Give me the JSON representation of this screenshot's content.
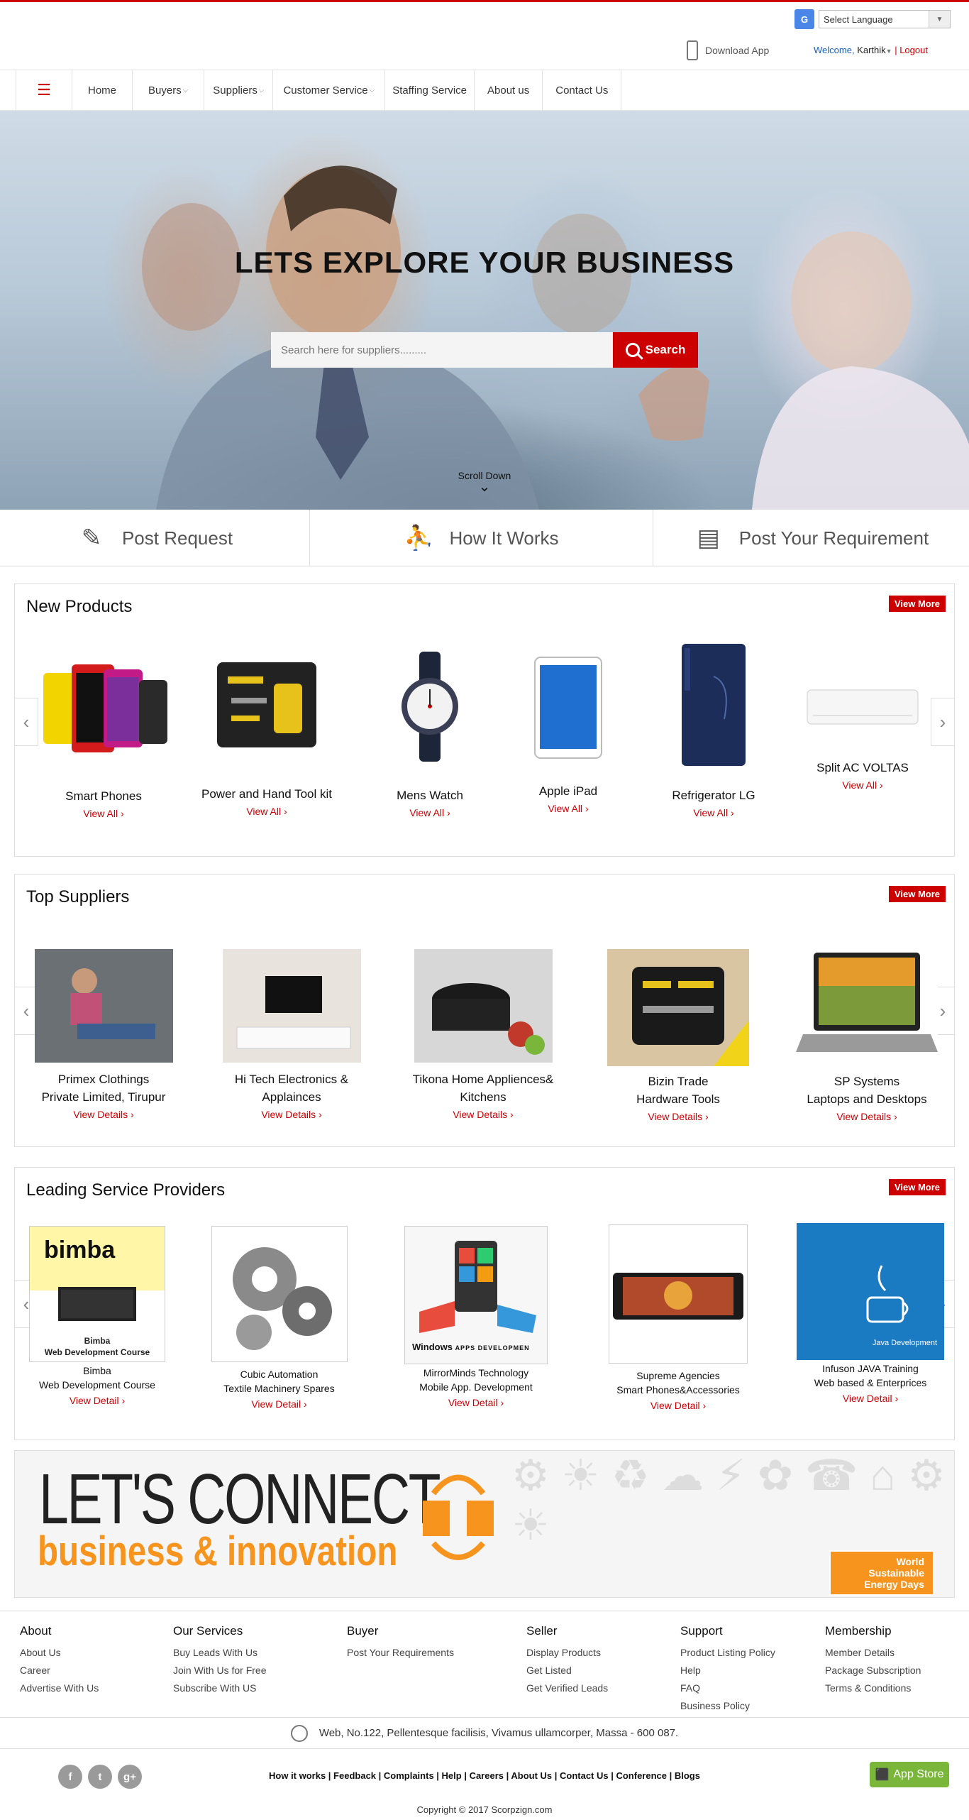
{
  "top": {
    "language_select": "Select Language",
    "download_app": "Download App",
    "welcome": "Welcome,",
    "user": "Karthik",
    "logout": "Logout"
  },
  "nav": {
    "items": [
      "Home",
      "Buyers",
      "Suppliers",
      "Customer Service",
      "Staffing Service",
      "About us",
      "Contact Us"
    ]
  },
  "hero": {
    "title": "LETS EXPLORE YOUR BUSINESS",
    "search_placeholder": "Search here for suppliers.........",
    "search_button": "Search",
    "scroll": "Scroll Down"
  },
  "actions": [
    "Post Request",
    "How It Works",
    "Post Your Requirement"
  ],
  "new_products": {
    "title": "New Products",
    "view_more": "View More",
    "items": [
      {
        "name": "Smart Phones",
        "link": "View All"
      },
      {
        "name": "Power and Hand Tool kit",
        "link": "View All"
      },
      {
        "name": "Mens Watch",
        "link": "View All"
      },
      {
        "name": "Apple  iPad",
        "link": "View All"
      },
      {
        "name": "Refrigerator LG",
        "link": "View All"
      },
      {
        "name": "Split AC VOLTAS",
        "link": "View All"
      }
    ]
  },
  "top_suppliers": {
    "title": "Top Suppliers",
    "view_more": "View More",
    "items": [
      {
        "line1": "Primex Clothings",
        "line2": "Private Limited, Tirupur",
        "link": "View Details"
      },
      {
        "line1": "Hi Tech Electronics &",
        "line2": "Applainces",
        "link": "View Details"
      },
      {
        "line1": "Tikona Home Appliences&",
        "line2": "Kitchens",
        "link": "View Details"
      },
      {
        "line1": "Bizin Trade",
        "line2": "Hardware Tools",
        "link": "View Details"
      },
      {
        "line1": "SP Systems",
        "line2": "Laptops and Desktops",
        "link": "View Details"
      }
    ]
  },
  "service_providers": {
    "title": "Leading Service Providers",
    "view_more": "View More",
    "items": [
      {
        "line1": "Bimba",
        "line2": "Web Development Course",
        "link": "View Detail",
        "img_text": "bimba",
        "img_caption1": "Bimba",
        "img_caption2": "Web Development Course"
      },
      {
        "line1": "Cubic Automation",
        "line2": "Textile Machinery Spares",
        "link": "View Detail"
      },
      {
        "line1": "MirrorMinds Technology",
        "line2": "Mobile App. Development",
        "link": "View Detail",
        "img_text": "Windows",
        "img_sub": "APPS DEVELOPMEN"
      },
      {
        "line1": "Supreme Agencies",
        "line2": "Smart Phones&Accessories",
        "link": "View Detail"
      },
      {
        "line1": "Infuson JAVA Training",
        "line2": "Web based & Enterprices",
        "link": "View Detail",
        "img_text": "Java Development"
      }
    ]
  },
  "banner": {
    "line1": "LET'S CONNECT",
    "line2": "business & innovation",
    "badge": "World Sustainable Energy Days"
  },
  "footer": {
    "columns": [
      {
        "title": "About",
        "links": [
          "About Us",
          "Career",
          "Advertise With Us"
        ]
      },
      {
        "title": "Our Services",
        "links": [
          "Buy Leads With Us",
          "Join With Us for Free",
          "Subscribe With US"
        ]
      },
      {
        "title": "Buyer",
        "links": [
          "Post Your Requirements"
        ]
      },
      {
        "title": "Seller",
        "links": [
          "Display Products",
          "Get Listed",
          "Get Verified Leads"
        ]
      },
      {
        "title": "Support",
        "links": [
          "Product Listing Policy",
          "Help",
          "FAQ",
          "Business Policy"
        ]
      },
      {
        "title": "Membership",
        "links": [
          "Member Details",
          "Package Subscription",
          "Terms & Conditions"
        ]
      }
    ],
    "address": "Web, No.122,  Pellentesque facilisis, Vivamus ullamcorper, Massa - 600 087.",
    "links": "How it works | Feedback | Complaints | Help | Careers | About Us  |  Contact Us | Conference | Blogs",
    "social": [
      "f",
      "t",
      "g+"
    ],
    "app_store": "App Store",
    "copyright": "Copyright ©  2017 Scorpzign.com"
  },
  "colors": {
    "accent": "#cc0000",
    "banner_orange": "#f7941d"
  }
}
